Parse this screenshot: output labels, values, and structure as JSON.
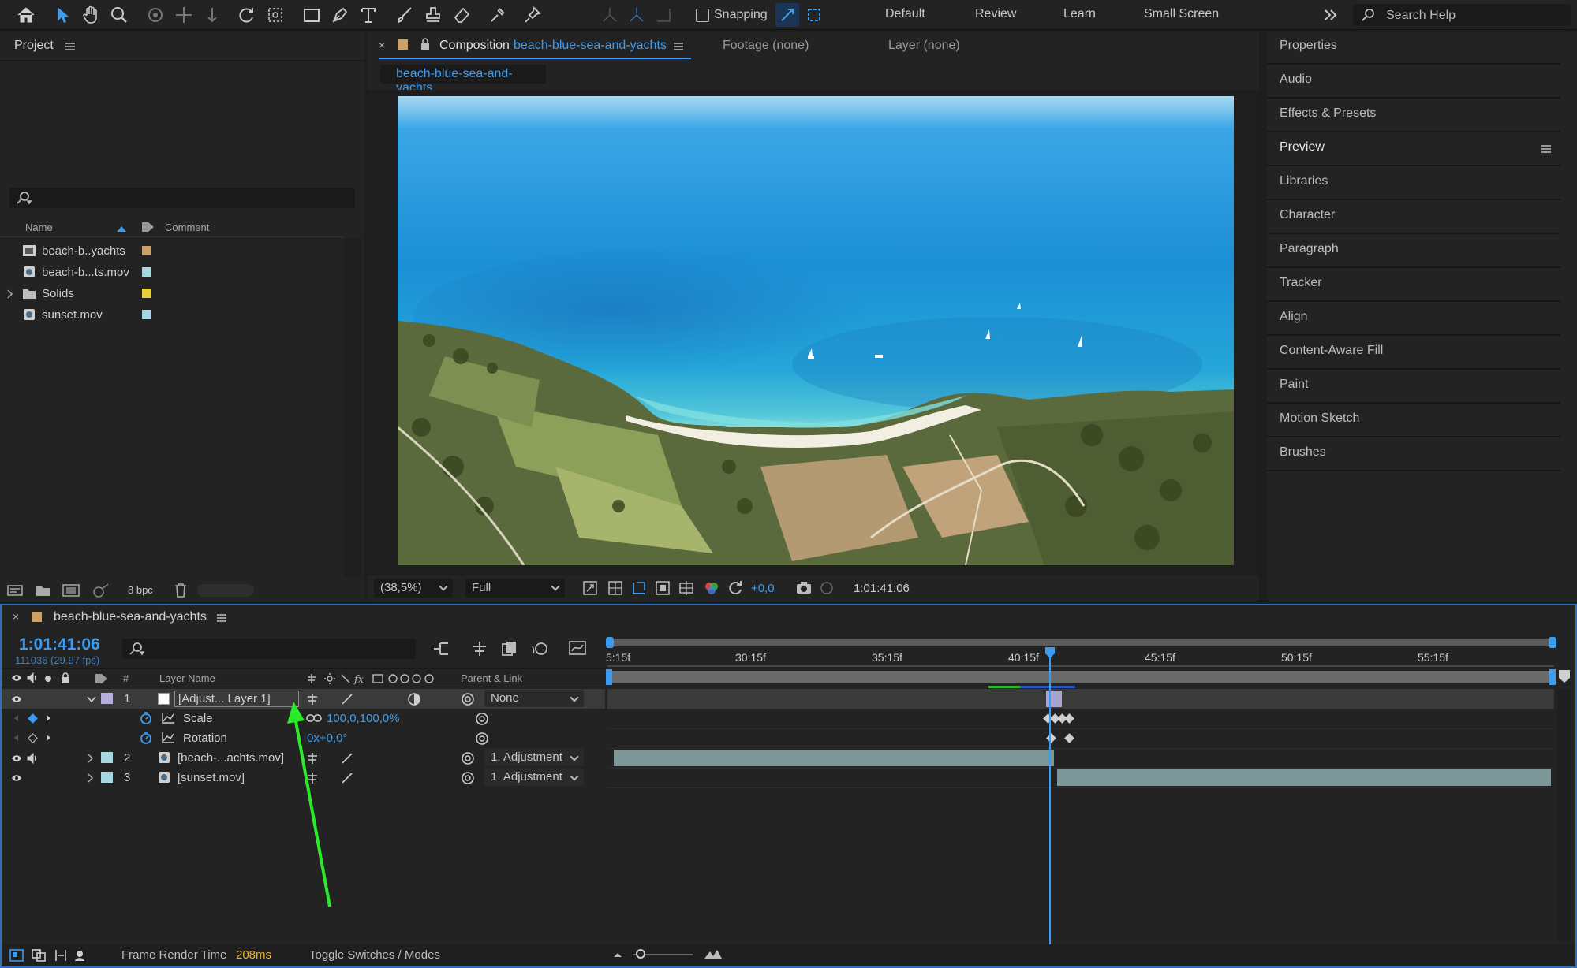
{
  "toolbar": {
    "snapping_label": "Snapping",
    "workspaces": [
      "Default",
      "Review",
      "Learn",
      "Small Screen"
    ],
    "search_placeholder": "Search Help"
  },
  "project": {
    "title": "Project",
    "columns": {
      "name": "Name",
      "comment": "Comment"
    },
    "items": [
      {
        "name": "beach-b..yachts",
        "type": "composition",
        "color": "#c9a26b"
      },
      {
        "name": "beach-b...ts.mov",
        "type": "footage",
        "color": "#a8d7e0"
      },
      {
        "name": "Solids",
        "type": "folder",
        "color": "#e6cf3a"
      },
      {
        "name": "sunset.mov",
        "type": "footage",
        "color": "#a8d7e0"
      }
    ],
    "bpc": "8 bpc"
  },
  "comp": {
    "tab_prefix": "Composition",
    "tab_name": "beach-blue-sea-and-yachts",
    "footage_tab": "Footage (none)",
    "layer_tab": "Layer (none)",
    "subtab": "beach-blue-sea-and-yachts",
    "zoom": "(38,5%)",
    "resolution": "Full",
    "exposure": "+0,0",
    "timecode": "1:01:41:06"
  },
  "right_panels": [
    "Properties",
    "Audio",
    "Effects & Presets",
    "Preview",
    "Libraries",
    "Character",
    "Paragraph",
    "Tracker",
    "Align",
    "Content-Aware Fill",
    "Paint",
    "Motion Sketch",
    "Brushes"
  ],
  "timeline": {
    "comp_name": "beach-blue-sea-and-yachts",
    "current_time": "1:01:41:06",
    "frame_info": "111036 (29.97 fps)",
    "col_layer_name": "Layer Name",
    "col_num": "#",
    "col_parent": "Parent & Link",
    "ruler_labels": [
      "5:15f",
      "30:15f",
      "35:15f",
      "40:15f",
      "45:15f",
      "50:15f",
      "55:15f"
    ],
    "layers": [
      {
        "num": "1",
        "name": "[Adjust... Layer 1]",
        "parent": "None",
        "color": "#b7b0dc"
      },
      {
        "num": "2",
        "name": "[beach-...achts.mov]",
        "parent": "1. Adjustment",
        "color": "#a8d7e0"
      },
      {
        "num": "3",
        "name": "[sunset.mov]",
        "parent": "1. Adjustment",
        "color": "#a8d7e0"
      }
    ],
    "props": [
      {
        "name": "Scale",
        "value": "100,0,100,0%"
      },
      {
        "name": "Rotation",
        "value": "0x+0,0°"
      }
    ],
    "status_label": "Frame Render Time",
    "status_value": "208ms",
    "toggle_label": "Toggle Switches / Modes"
  }
}
